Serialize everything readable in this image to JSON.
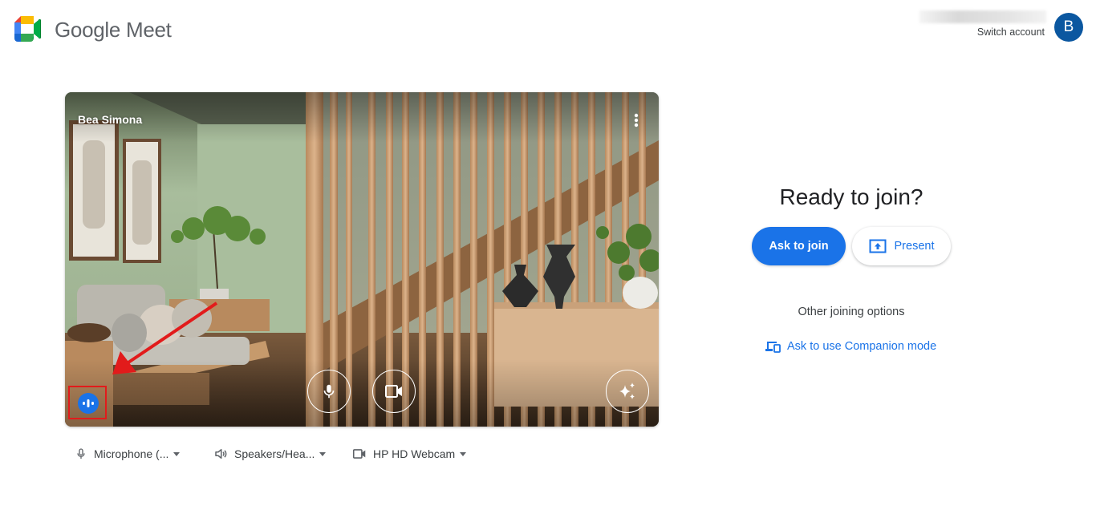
{
  "header": {
    "brand": "Google Meet",
    "account": {
      "switch_label": "Switch account",
      "avatar_initial": "B",
      "avatar_color": "#0b57a0"
    }
  },
  "preview": {
    "participant_name": "Bea Simona",
    "controls": [
      {
        "name": "microphone",
        "icon": "mic-icon",
        "state": "on"
      },
      {
        "name": "camera",
        "icon": "videocam-icon",
        "state": "on"
      },
      {
        "name": "visual-effects",
        "icon": "sparkle-icon"
      }
    ],
    "more_options_icon": "more-vert-icon",
    "speaking_indicator_icon": "audio-level-icon",
    "annotation": {
      "type": "red-arrow-and-box",
      "color": "#e21b1b",
      "target": "speaking-indicator"
    }
  },
  "devices": {
    "microphone": "Microphone (...",
    "speakers": "Speakers/Hea...",
    "camera": "HP HD Webcam"
  },
  "join_panel": {
    "title": "Ready to join?",
    "ask_to_join": "Ask to join",
    "present": "Present",
    "other_options": "Other joining options",
    "companion_mode": "Ask to use Companion mode",
    "accent_color": "#1a73e8"
  }
}
